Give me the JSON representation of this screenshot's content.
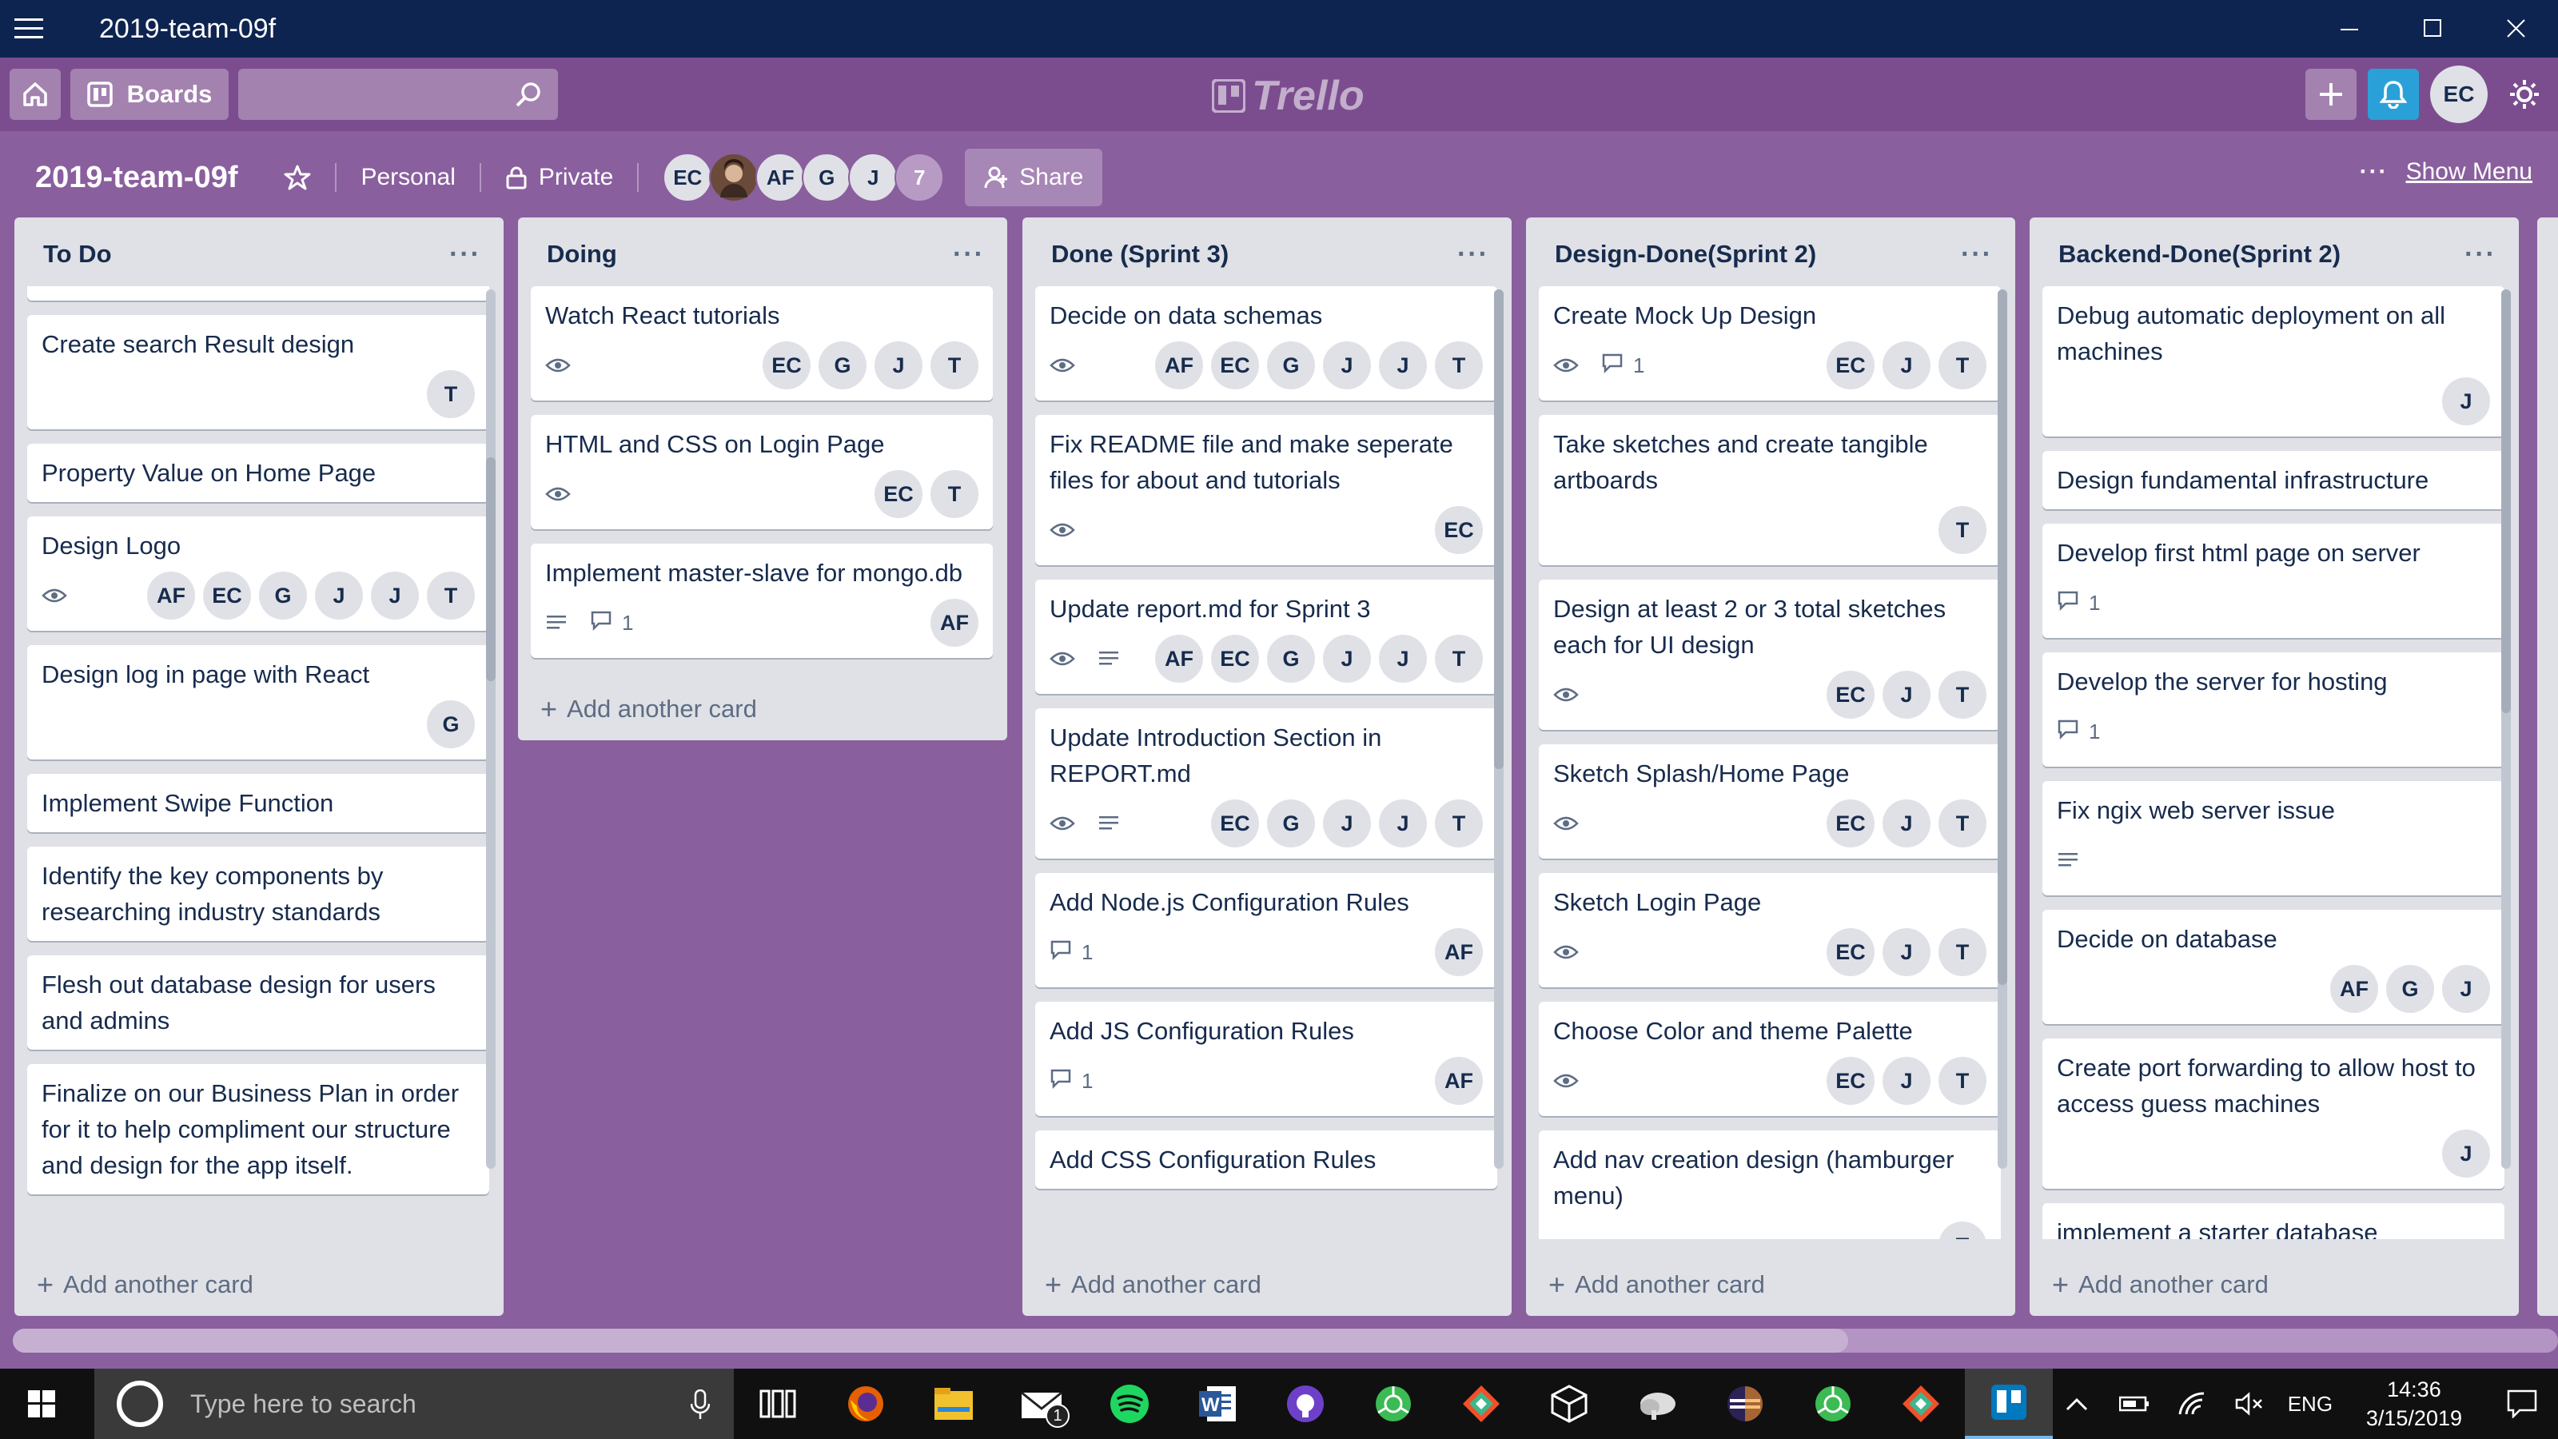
{
  "window": {
    "title": "2019-team-09f"
  },
  "header": {
    "boards_label": "Boards",
    "search_placeholder": "",
    "logo_text": "Trello",
    "user_initials": "EC"
  },
  "board": {
    "name": "2019-team-09f",
    "team": "Personal",
    "visibility": "Private",
    "members": [
      "EC",
      "",
      "AF",
      "G",
      "J"
    ],
    "member_count": "7",
    "share_label": "Share",
    "show_menu_label": "Show Menu"
  },
  "lists": [
    {
      "title": "To Do",
      "add_label": "Add another card",
      "cards": [
        {
          "text": "Create search Result design",
          "badges": [],
          "members": [
            "T"
          ]
        },
        {
          "text": "Property Value on Home Page",
          "badges": [],
          "members": []
        },
        {
          "text": "Design Logo",
          "badges": [
            "watch"
          ],
          "members": [
            "AF",
            "EC",
            "G",
            "J",
            "J",
            "T"
          ]
        },
        {
          "text": "Design log in page with React",
          "badges": [],
          "members": [
            "G"
          ]
        },
        {
          "text": "Implement Swipe Function",
          "badges": [],
          "members": []
        },
        {
          "text": "Identify the key components by researching industry standards",
          "badges": [],
          "members": []
        },
        {
          "text": "Flesh out database design for users and admins",
          "badges": [],
          "members": []
        },
        {
          "text": "Finalize on our Business Plan in order for it to help compliment our structure and design for the app itself.",
          "badges": [],
          "members": []
        }
      ]
    },
    {
      "title": "Doing",
      "add_label": "Add another card",
      "cards": [
        {
          "text": "Watch React tutorials",
          "badges": [
            "watch"
          ],
          "members": [
            "EC",
            "G",
            "J",
            "T"
          ]
        },
        {
          "text": "HTML and CSS on Login Page",
          "badges": [
            "watch"
          ],
          "members": [
            "EC",
            "T"
          ]
        },
        {
          "text": "Implement master-slave for mongo.db",
          "badges": [
            "desc",
            "comment"
          ],
          "comments": "1",
          "members": [
            "AF"
          ]
        }
      ]
    },
    {
      "title": "Done (Sprint 3)",
      "add_label": "Add another card",
      "cards": [
        {
          "text": "Decide on data schemas",
          "badges": [
            "watch"
          ],
          "members": [
            "AF",
            "EC",
            "G",
            "J",
            "J",
            "T"
          ]
        },
        {
          "text": "Fix README file and make seperate files for about and tutorials",
          "badges": [
            "watch"
          ],
          "members": [
            "EC"
          ]
        },
        {
          "text": "Update report.md for Sprint 3",
          "badges": [
            "watch",
            "desc"
          ],
          "members": [
            "AF",
            "EC",
            "G",
            "J",
            "J",
            "T"
          ]
        },
        {
          "text": "Update Introduction Section in REPORT.md",
          "badges": [
            "watch",
            "desc"
          ],
          "members": [
            "EC",
            "G",
            "J",
            "J",
            "T"
          ]
        },
        {
          "text": "Add Node.js Configuration Rules",
          "badges": [
            "comment"
          ],
          "comments": "1",
          "members": [
            "AF"
          ]
        },
        {
          "text": "Add JS Configuration Rules",
          "badges": [
            "comment"
          ],
          "comments": "1",
          "members": [
            "AF"
          ]
        },
        {
          "text": "Add CSS Configuration Rules",
          "badges": [],
          "members": []
        }
      ]
    },
    {
      "title": "Design-Done(Sprint 2)",
      "add_label": "Add another card",
      "cards": [
        {
          "text": "Create Mock Up Design",
          "badges": [
            "watch",
            "comment"
          ],
          "comments": "1",
          "members": [
            "EC",
            "J",
            "T"
          ]
        },
        {
          "text": "Take sketches and create tangible artboards",
          "badges": [],
          "members": [
            "T"
          ]
        },
        {
          "text": "Design at least 2 or 3 total sketches each for UI design",
          "badges": [
            "watch"
          ],
          "members": [
            "EC",
            "J",
            "T"
          ]
        },
        {
          "text": "Sketch Splash/Home Page",
          "badges": [
            "watch"
          ],
          "members": [
            "EC",
            "J",
            "T"
          ]
        },
        {
          "text": "Sketch Login Page",
          "badges": [
            "watch"
          ],
          "members": [
            "EC",
            "J",
            "T"
          ]
        },
        {
          "text": "Choose Color and theme Palette",
          "badges": [
            "watch"
          ],
          "members": [
            "EC",
            "J",
            "T"
          ]
        },
        {
          "text": "Add nav creation design (hamburger menu)",
          "badges": [],
          "members": [
            "T"
          ]
        }
      ]
    },
    {
      "title": "Backend-Done(Sprint 2)",
      "add_label": "Add another card",
      "cards": [
        {
          "text": "Debug automatic deployment on all machines",
          "badges": [],
          "members": [
            "J"
          ]
        },
        {
          "text": "Design fundamental infrastructure",
          "badges": [],
          "members": []
        },
        {
          "text": "Develop first html page on server",
          "badges": [
            "comment"
          ],
          "comments": "1",
          "members": []
        },
        {
          "text": "Develop the server for hosting",
          "badges": [
            "comment"
          ],
          "comments": "1",
          "members": []
        },
        {
          "text": "Fix ngix web server issue",
          "badges": [
            "desc"
          ],
          "members": []
        },
        {
          "text": "Decide on database",
          "badges": [],
          "members": [
            "AF",
            "G",
            "J"
          ]
        },
        {
          "text": "Create port forwarding to allow host to access guess machines",
          "badges": [],
          "members": [
            "J"
          ]
        },
        {
          "text": "implement a starter database",
          "badges": [],
          "members": []
        }
      ]
    }
  ],
  "taskbar": {
    "search_placeholder": "Type here to search",
    "language": "ENG",
    "time": "14:36",
    "date": "3/15/2019",
    "mail_badge": "1"
  }
}
